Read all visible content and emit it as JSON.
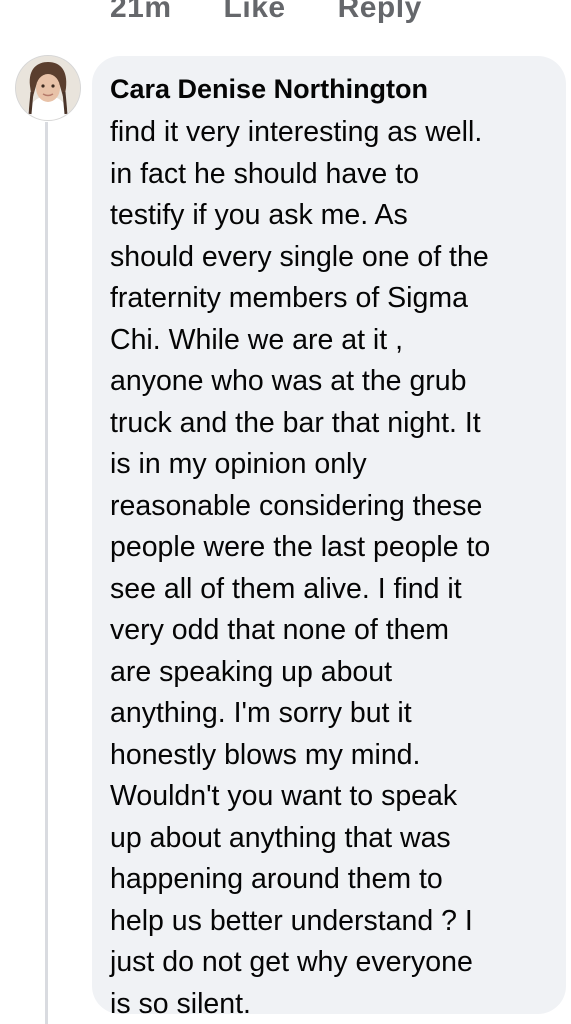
{
  "actions": {
    "time": "21m",
    "like": "Like",
    "reply": "Reply"
  },
  "comment": {
    "author": "Cara Denise Northington",
    "text": "find it very interesting as well.\nin fact he should have to\ntestify if you ask me. As\nshould every single one of the\nfraternity members of Sigma\nChi. While we are at it ,\nanyone who was at the grub\ntruck and the bar that night. It\nis in my opinion only\nreasonable considering these\npeople were the last people to\nsee all of them alive. I find it\nvery odd that none of them\nare speaking up about\nanything. I'm sorry but it\nhonestly blows my mind.\nWouldn't you want to speak\nup about anything that was\nhappening around them to\nhelp us better understand ? I\njust do not get why everyone\nis so silent."
  }
}
